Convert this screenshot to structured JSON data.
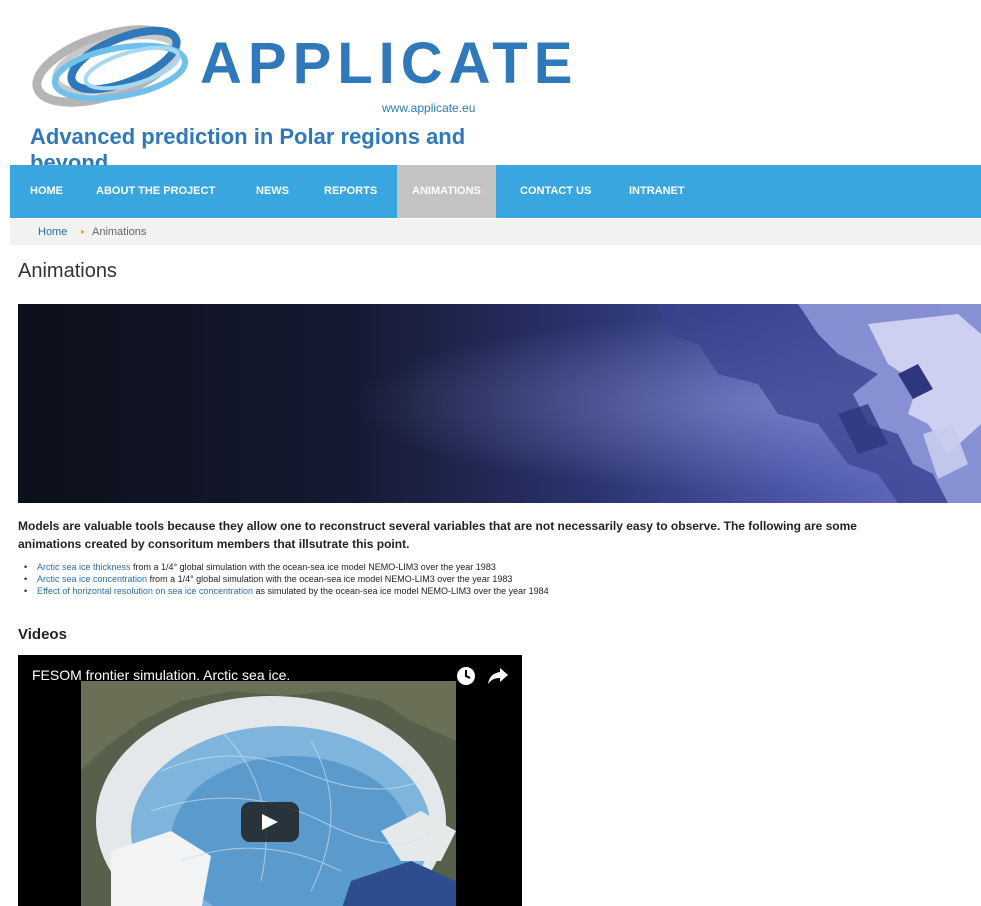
{
  "logo": {
    "brand": "APPLICATE",
    "url": "www.applicate.eu",
    "tagline": "Advanced prediction in Polar regions and beyond"
  },
  "nav": {
    "items": [
      {
        "label": "HOME"
      },
      {
        "label": "ABOUT THE PROJECT"
      },
      {
        "label": "NEWS"
      },
      {
        "label": "REPORTS"
      },
      {
        "label": "ANIMATIONS",
        "active": true
      },
      {
        "label": "CONTACT US"
      },
      {
        "label": "INTRANET"
      }
    ],
    "bar_color": "#3aa6df",
    "active_color": "#c3c3c3"
  },
  "breadcrumb": {
    "home": "Home",
    "separator": "▸",
    "current": "Animations"
  },
  "page": {
    "title": "Animations",
    "intro_line1": "Models are valuable tools because they allow one to reconstruct several variables that are not necessarily easy to observe. The following are some",
    "intro_line2": "animations created by consoritum members that illsutrate this point.",
    "links": [
      {
        "link": "Arctic sea ice thickness",
        "rest": " from a 1/4° global simulation with the ocean-sea ice model NEMO-LIM3 over the year 1983"
      },
      {
        "link": "Arctic sea ice concentration",
        "rest": " from a 1/4° global simulation with the ocean-sea ice model NEMO-LIM3 over the year 1983"
      },
      {
        "link": "Effect of horizontal resolution on sea ice concentration",
        "rest": " as simulated by the ocean-sea ice model NEMO-LIM3 over the year 1984"
      }
    ]
  },
  "videos": {
    "heading": "Videos",
    "video_title": "FESOM frontier simulation. Arctic sea ice.",
    "icons": [
      "clock-icon",
      "share-icon",
      "play-icon"
    ]
  }
}
